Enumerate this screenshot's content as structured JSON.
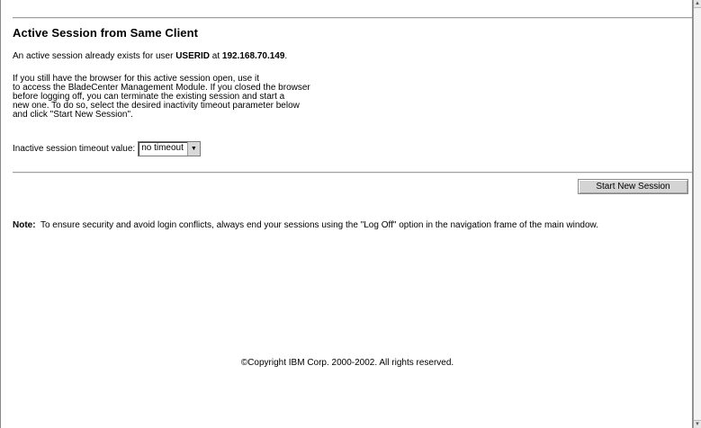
{
  "dialog": {
    "title": "Active Session from Same Client",
    "session_text_prefix": "An active session already exists for user ",
    "user_id": "USERID",
    "session_text_mid": " at ",
    "ip_address": "192.168.70.149",
    "session_text_suffix": ".",
    "instructions": [
      "If you still have the browser for this active session open, use it",
      "to access the BladeCenter Management Module. If you closed the browser",
      "before logging off, you can terminate the existing session and start a",
      "new one. To do so, select the desired inactivity timeout parameter below",
      "and click \"Start New Session\"."
    ],
    "timeout_label": "Inactive session timeout value:",
    "timeout_selected": "no timeout",
    "start_button_label": "Start New Session",
    "note_label": "Note:",
    "note_text": "To ensure security and avoid login conflicts, always end your sessions using the \"Log Off\" option in the navigation frame of the main window.",
    "copyright": "©Copyright IBM Corp. 2000-2002. All rights reserved."
  },
  "icons": {
    "dropdown": "chevron-down-icon",
    "scroll_up": "arrow-up-icon",
    "scroll_down": "arrow-down-icon"
  }
}
